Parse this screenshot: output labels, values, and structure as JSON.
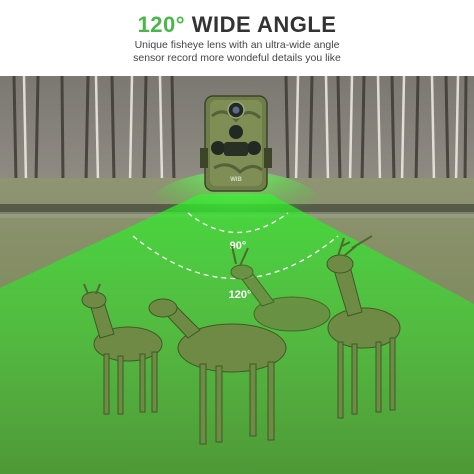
{
  "header": {
    "title_accent": "120°",
    "title_rest": "WIDE ANGLE",
    "subtitle_line1": "Unique fisheye lens with an ultra-wide angle",
    "subtitle_line2": "sensor record more wondeful details you like"
  },
  "diagram": {
    "inner_angle_label": "90°",
    "outer_angle_label": "120°"
  },
  "camera": {
    "brand_mark": "WiB"
  },
  "colors": {
    "accent": "#49b84a",
    "beam": "#2ee82a",
    "title_text": "#333333"
  }
}
